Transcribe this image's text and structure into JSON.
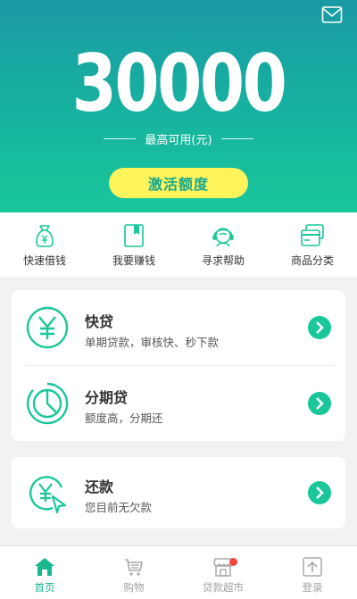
{
  "hero": {
    "amount": "30000",
    "available_label": "最高可用(元)",
    "activate_label": "激活额度"
  },
  "shortcuts": [
    {
      "label": "快速借钱",
      "icon": "money-bag-icon"
    },
    {
      "label": "我要赚钱",
      "icon": "bookmark-book-icon"
    },
    {
      "label": "寻求帮助",
      "icon": "headset-agent-icon"
    },
    {
      "label": "商品分类",
      "icon": "cards-icon"
    }
  ],
  "products": [
    {
      "title": "快贷",
      "desc": "单期贷款，审核快、秒下款",
      "icon": "yen-circle-icon"
    },
    {
      "title": "分期贷",
      "desc": "额度高，分期还",
      "icon": "pie-chart-icon"
    }
  ],
  "repay": {
    "title": "还款",
    "desc": "您目前无欠款",
    "icon": "yen-cursor-icon"
  },
  "tabs": [
    {
      "label": "首页",
      "icon": "home-icon",
      "active": true
    },
    {
      "label": "购物",
      "icon": "cart-icon",
      "active": false
    },
    {
      "label": "贷款超市",
      "icon": "store-icon",
      "active": false
    },
    {
      "label": "登录",
      "icon": "upload-icon",
      "active": false
    }
  ],
  "colors": {
    "accent": "#19c79a",
    "button": "#fdf35b",
    "badge": "#f2453d"
  }
}
